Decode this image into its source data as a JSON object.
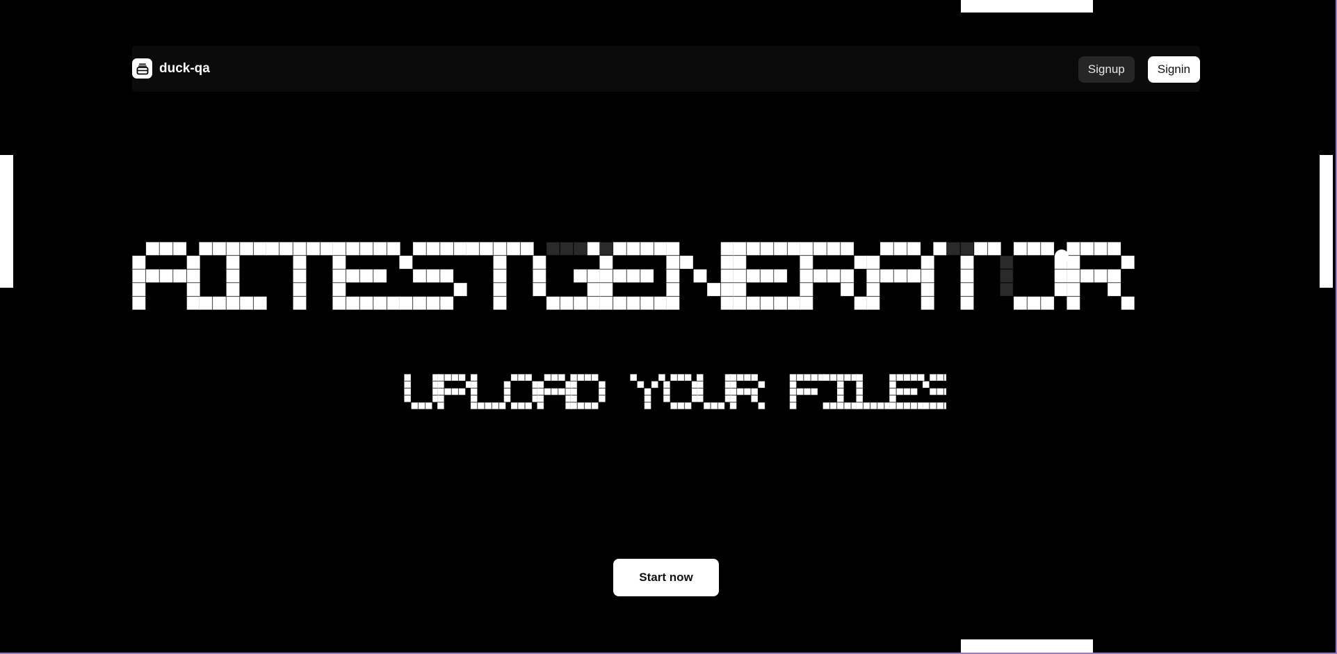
{
  "navbar": {
    "brand_name": "duck-qa",
    "brand_icon": "archive-box-icon",
    "signup_label": "Signup",
    "signin_label": "Signin"
  },
  "hero": {
    "title": "AITESTGENERATOR",
    "subtitle": "UPLOAD YOUR FILES",
    "start_label": "Start now"
  },
  "colors": {
    "background": "#000000",
    "pixel_lit": "#ffffff",
    "pixel_broken": "#2a2a2a",
    "navbar_bg": "#0b0b0b",
    "signup_bg": "#262626",
    "frame_border": "#9b7bc8"
  }
}
